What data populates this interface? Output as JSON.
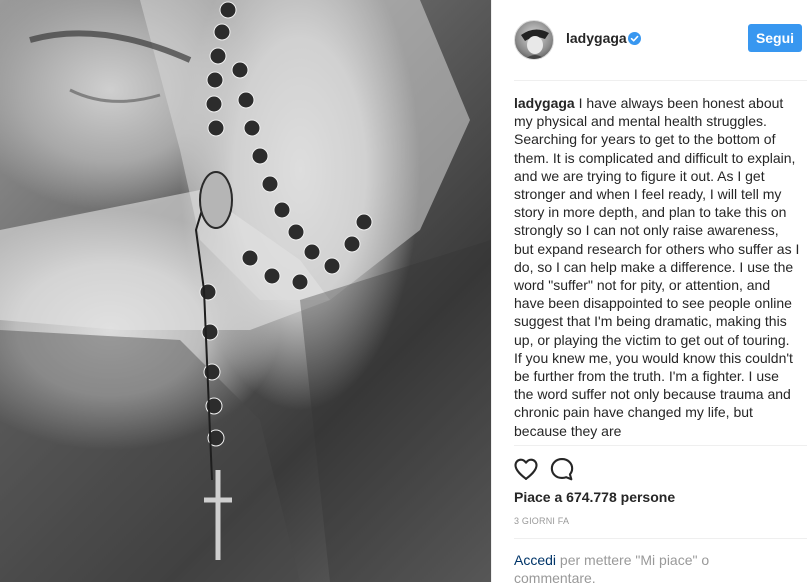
{
  "post": {
    "username": "ladygaga",
    "verified_icon": "verified-badge-icon",
    "follow_label": "Segui",
    "caption_user": "ladygaga",
    "caption_text": " I have always been honest about my physical and mental health struggles. Searching for years to get to the bottom of them. It is complicated and difficult to explain, and we are trying to figure it out. As I get stronger and when I feel ready, I will tell my story in more depth, and plan to take this on strongly so I can not only raise awareness, but expand research for others who suffer as I do, so I can help make a difference. I use the word \"suffer\" not for pity, or attention, and have been disappointed to see people online suggest that I'm being dramatic, making this up, or playing the victim to get out of touring. If you knew me, you would know this couldn't be further from the truth. I'm a fighter. I use the word suffer not only because trauma and chronic pain have changed my life, but because they are",
    "likes": "Piace a 674.778 persone",
    "time_ago": "3 giorni fa",
    "login_link": "Accedi",
    "login_rest": " per mettere \"Mi piace\" o commentare."
  },
  "icons": {
    "like": "heart-icon",
    "comment": "comment-bubble-icon"
  },
  "colors": {
    "follow_button": "#3897f0",
    "verified_badge": "#3897f0",
    "link": "#003569",
    "meta_text": "#999999"
  }
}
